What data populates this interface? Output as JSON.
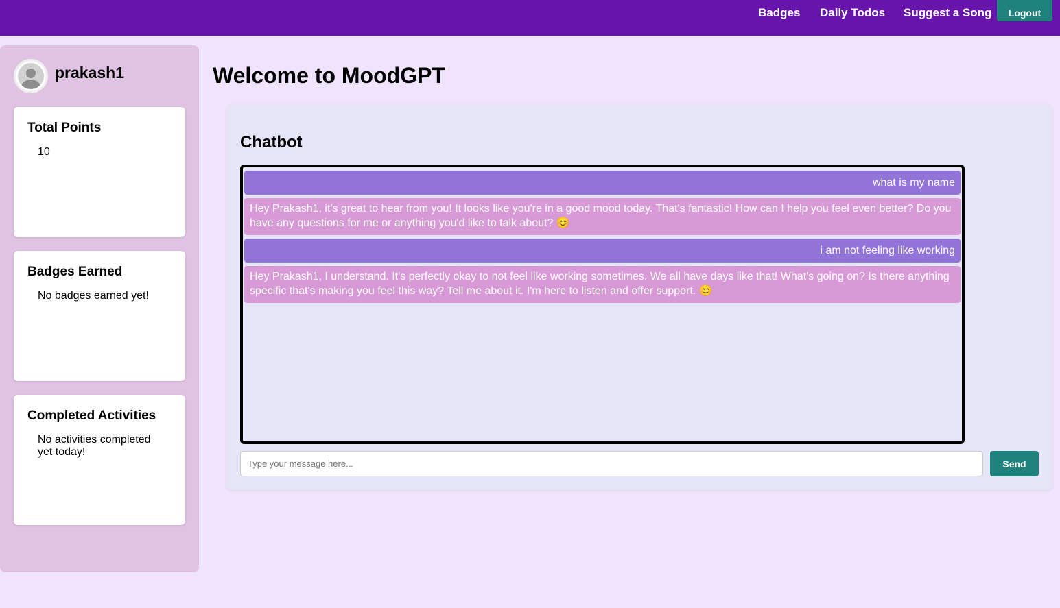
{
  "nav": {
    "links": [
      "Badges",
      "Daily Todos",
      "Suggest a Song"
    ],
    "logout_label": "Logout"
  },
  "sidebar": {
    "username": "prakash1",
    "avatar_icon": "user-avatar-icon",
    "cards": [
      {
        "title": "Total Points",
        "body": "10"
      },
      {
        "title": "Badges Earned",
        "body": "No badges earned yet!"
      },
      {
        "title": "Completed Activities",
        "body": "No activities completed yet today!"
      }
    ]
  },
  "main": {
    "title": "Welcome to MoodGPT",
    "chat": {
      "heading": "Chatbot",
      "messages": [
        {
          "role": "user",
          "text": "what is my name"
        },
        {
          "role": "bot",
          "text": "Hey Prakash1, it's great to hear from you! It looks like you're in a good mood today. That's fantastic! How can I help you feel even better? Do you have any questions for me or anything you'd like to talk about? 😊"
        },
        {
          "role": "user",
          "text": "i am not feeling like working"
        },
        {
          "role": "bot",
          "text": "Hey Prakash1, I understand. It's perfectly okay to not feel like working sometimes. We all have days like that! What's going on? Is there anything specific that's making you feel this way? Tell me about it. I'm here to listen and offer support. 😊"
        }
      ],
      "input_placeholder": "Type your message here...",
      "input_value": "",
      "send_label": "Send"
    }
  },
  "colors": {
    "topbar": "#6614aa",
    "accent_button": "#20827d",
    "user_bubble": "#9273d8",
    "bot_bubble": "#d89ad6",
    "sidebar": "#e0c2e2",
    "page_bg": "#efe4fb"
  }
}
